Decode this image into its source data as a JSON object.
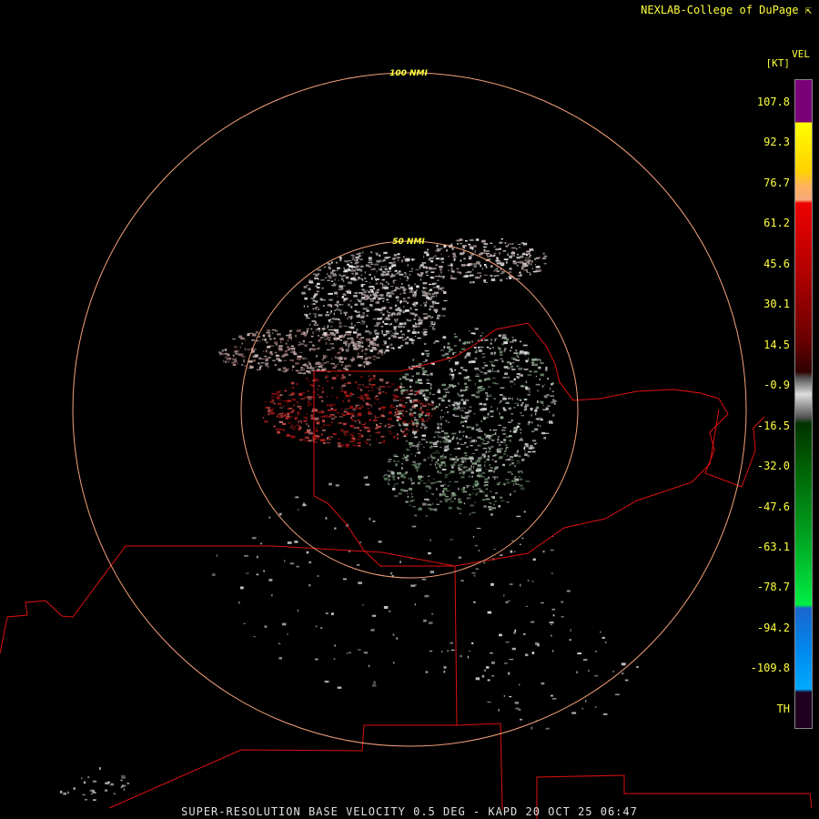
{
  "header": {
    "credit": "NEXLAB-College of DuPage",
    "credit_icon": "corner-arrow-icon"
  },
  "footer": {
    "caption": "SUPER-RESOLUTION BASE VELOCITY 0.5 DEG - KAPD 20 OCT 25 06:47"
  },
  "rings": [
    {
      "label": "100 NMI"
    },
    {
      "label": "50 NMI"
    }
  ],
  "legend": {
    "product": "VEL",
    "unit": "[KT]",
    "labels": [
      "107.8",
      "92.3",
      "76.7",
      "61.2",
      "45.6",
      "30.1",
      "14.5",
      "-0.9",
      "-16.5",
      "-32.0",
      "-47.6",
      "-63.1",
      "-78.7",
      "-94.2",
      "-109.8",
      "TH"
    ],
    "colors": {
      "purple": "#7a007a",
      "yellow": "#ffff00",
      "peach": "#f5a97a",
      "red": "#ee0000",
      "dark_red": "#6a0000",
      "gray": "#9a9a9a",
      "dark_green": "#005500",
      "green": "#00ee44",
      "blue": "#1a66cc",
      "cyan": "#00aaff",
      "th": "#200020"
    }
  },
  "colors": {
    "background": "#000000",
    "range_ring": "#f4a27a",
    "boundary": "#dd1111",
    "label_yellow": "#ffff3c"
  }
}
